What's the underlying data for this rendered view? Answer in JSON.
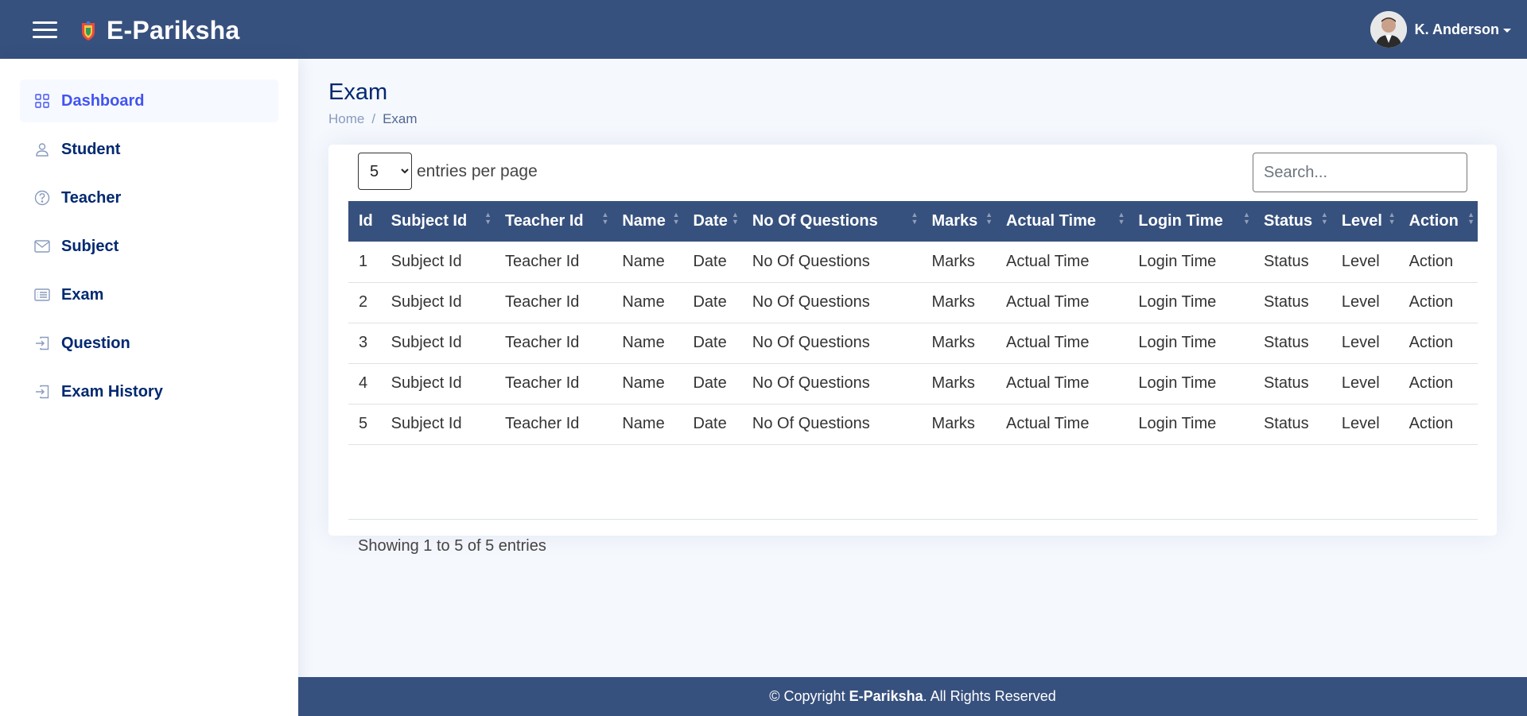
{
  "header": {
    "brand": "E-Pariksha",
    "user_name": "K. Anderson",
    "colors": {
      "bar": "#37517e",
      "text": "#ffffff"
    }
  },
  "sidebar": {
    "items": [
      {
        "label": "Dashboard",
        "icon": "grid-icon",
        "active": true
      },
      {
        "label": "Student",
        "icon": "person-icon"
      },
      {
        "label": "Teacher",
        "icon": "question-circle-icon"
      },
      {
        "label": "Subject",
        "icon": "envelope-icon"
      },
      {
        "label": "Exam",
        "icon": "card-list-icon"
      },
      {
        "label": "Question",
        "icon": "box-arrow-in-right-icon"
      },
      {
        "label": "Exam History",
        "icon": "box-arrow-in-right-icon"
      }
    ]
  },
  "page": {
    "title": "Exam",
    "breadcrumb": {
      "home": "Home",
      "sep": "/",
      "current": "Exam"
    }
  },
  "table": {
    "entries_value": "5",
    "entries_label": "entries per page",
    "search_placeholder": "Search...",
    "columns": [
      "Id",
      "Subject Id",
      "Teacher Id",
      "Name",
      "Date",
      "No Of Questions",
      "Marks",
      "Actual Time",
      "Login Time",
      "Status",
      "Level",
      "Action"
    ],
    "rows": [
      [
        "1",
        "Subject Id",
        "Teacher Id",
        "Name",
        "Date",
        "No Of Questions",
        "Marks",
        "Actual Time",
        "Login Time",
        "Status",
        "Level",
        "Action"
      ],
      [
        "2",
        "Subject Id",
        "Teacher Id",
        "Name",
        "Date",
        "No Of Questions",
        "Marks",
        "Actual Time",
        "Login Time",
        "Status",
        "Level",
        "Action"
      ],
      [
        "3",
        "Subject Id",
        "Teacher Id",
        "Name",
        "Date",
        "No Of Questions",
        "Marks",
        "Actual Time",
        "Login Time",
        "Status",
        "Level",
        "Action"
      ],
      [
        "4",
        "Subject Id",
        "Teacher Id",
        "Name",
        "Date",
        "No Of Questions",
        "Marks",
        "Actual Time",
        "Login Time",
        "Status",
        "Level",
        "Action"
      ],
      [
        "5",
        "Subject Id",
        "Teacher Id",
        "Name",
        "Date",
        "No Of Questions",
        "Marks",
        "Actual Time",
        "Login Time",
        "Status",
        "Level",
        "Action"
      ]
    ],
    "info": "Showing 1 to 5 of 5 entries"
  },
  "footer": {
    "prefix": "© Copyright ",
    "brand": "E-Pariksha",
    "suffix": ". All Rights Reserved"
  }
}
